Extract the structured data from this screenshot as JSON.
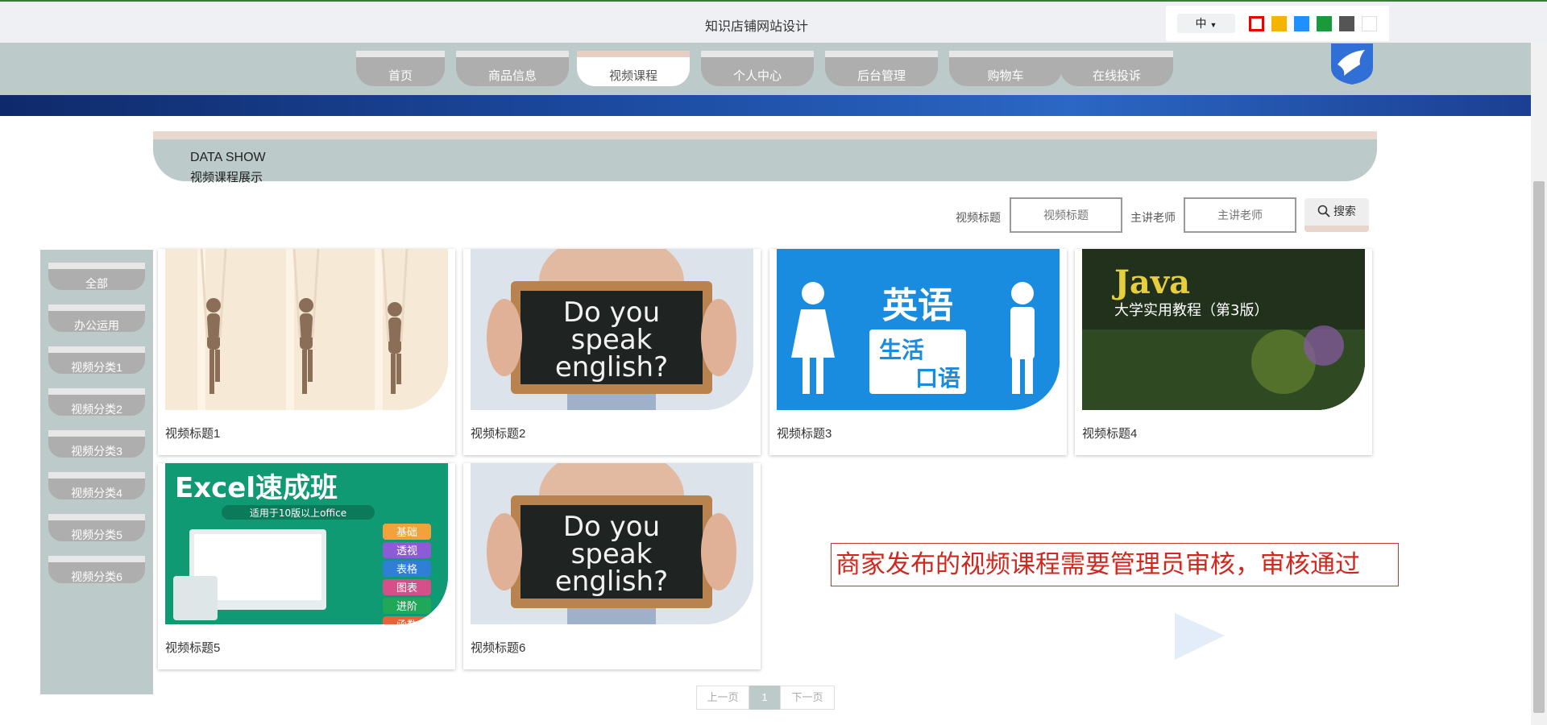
{
  "header": {
    "title": "知识店铺网站设计",
    "lang_label": "中",
    "swatches": [
      "#ff0000",
      "#f5b400",
      "#1e90ff",
      "#1a9a3a",
      "#555555",
      "#ffffff"
    ]
  },
  "nav": {
    "items": [
      "首页",
      "商品信息",
      "视频课程",
      "个人中心",
      "后台管理",
      "购物车",
      "在线投诉"
    ],
    "active": "视频课程"
  },
  "section": {
    "title_en": "DATA SHOW",
    "title_cn": "视频课程展示"
  },
  "search": {
    "title_label": "视频标题",
    "title_placeholder": "视频标题",
    "teacher_label": "主讲老师",
    "teacher_placeholder": "主讲老师",
    "button_label": "搜索"
  },
  "sidebar": {
    "items": [
      "全部",
      "办公运用",
      "视频分类1",
      "视频分类2",
      "视频分类3",
      "视频分类4",
      "视频分类5",
      "视频分类6"
    ]
  },
  "cards": [
    {
      "title": "视频标题1",
      "thumb": "yoga-photo"
    },
    {
      "title": "视频标题2",
      "thumb": "do-you-speak-english",
      "sign": [
        "Do you",
        "speak",
        "english?"
      ]
    },
    {
      "title": "视频标题3",
      "thumb": "english-life-talk",
      "sign": [
        "英语",
        "生活",
        "口语"
      ]
    },
    {
      "title": "视频标题4",
      "thumb": "java-book",
      "sign": [
        "Java",
        "大学实用教程（第3版）"
      ]
    },
    {
      "title": "视频标题5",
      "thumb": "excel-course",
      "sign": [
        "Excel速成班",
        "适用于10版以上office",
        "基础",
        "透视",
        "表格",
        "图表",
        "进阶",
        "函数"
      ]
    },
    {
      "title": "视频标题6",
      "thumb": "do-you-speak-english",
      "sign": [
        "Do you",
        "speak",
        "english?"
      ]
    }
  ],
  "pagination": {
    "prev": "上一页",
    "current": "1",
    "next": "下一页"
  },
  "annotation": {
    "text": "商家发布的视频课程需要管理员审核，审核通过"
  }
}
